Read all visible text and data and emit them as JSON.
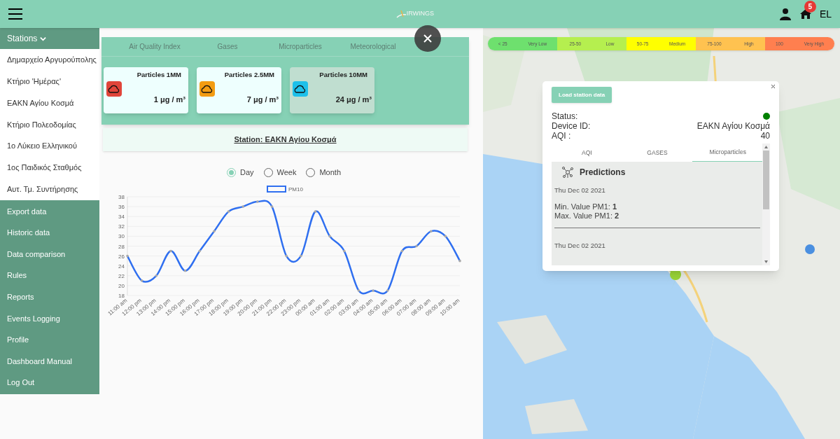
{
  "header": {
    "logo": "IRWINGS",
    "notification_count": "5",
    "language": "EL"
  },
  "sidebar": {
    "section": {
      "label": "Stations",
      "expanded": true
    },
    "stations": [
      {
        "label": "Δημαρχείο Αργυρούπολης"
      },
      {
        "label": "Κτήριο 'Ημέρας'"
      },
      {
        "label": "ΕΑΚΝ Αγίου Κοσμά"
      },
      {
        "label": "Κτήριο Πολεοδομίας"
      },
      {
        "label": "1ο Λύκειο Ελληνικού"
      },
      {
        "label": "1ος Παιδικός Σταθμός"
      },
      {
        "label": "Αυτ. Τμ. Συντήρησης"
      }
    ],
    "items": [
      {
        "label": "Export data"
      },
      {
        "label": "Historic data"
      },
      {
        "label": "Data comparison"
      },
      {
        "label": "Rules"
      },
      {
        "label": "Reports"
      },
      {
        "label": "Events Logging"
      },
      {
        "label": "Profile"
      },
      {
        "label": "Dashboard Manual"
      },
      {
        "label": "Log Out"
      }
    ]
  },
  "panel": {
    "tabs": [
      {
        "label": "Air Quality Index"
      },
      {
        "label": "Gases"
      },
      {
        "label": "Microparticles"
      },
      {
        "label": "Meteorological"
      }
    ],
    "cards": [
      {
        "title": "Particles 1MM",
        "value": "1 μg / m³",
        "color": "#e0453a",
        "selected": false
      },
      {
        "title": "Particles 2.5MM",
        "value": "7 μg / m³",
        "color": "#f39c12",
        "selected": false
      },
      {
        "title": "Particles 10MM",
        "value": "24 μg / m³",
        "color": "#1ec0ea",
        "selected": true
      }
    ],
    "station_title": "Station: ΕΑΚΝ Αγίου Κοσμά",
    "periods": [
      {
        "label": "Day",
        "selected": true
      },
      {
        "label": "Week",
        "selected": false
      },
      {
        "label": "Month",
        "selected": false
      }
    ],
    "chart_data": {
      "type": "line",
      "categories": [
        "11:00 am",
        "12:00 pm",
        "13:00 pm",
        "14:00 pm",
        "15:00 pm",
        "16:00 pm",
        "17:00 pm",
        "18:00 pm",
        "19:00 pm",
        "20:00 pm",
        "21:00 pm",
        "22:00 pm",
        "23:00 pm",
        "00:00 am",
        "01:00 am",
        "02:00 am",
        "03:00 am",
        "04:00 am",
        "05:00 am",
        "06:00 am",
        "07:00 am",
        "08:00 am",
        "09:00 am",
        "10:00 am"
      ],
      "series": [
        {
          "name": "PM10",
          "color": "#2f6ff0",
          "values": [
            26,
            21,
            22,
            27,
            23,
            27,
            31,
            35,
            36,
            37,
            36,
            26,
            26,
            35,
            30,
            27,
            19,
            19,
            19,
            27,
            28,
            31,
            30,
            25
          ]
        }
      ],
      "grid": true,
      "ylim": [
        18,
        38
      ],
      "yticks": [
        18,
        20,
        22,
        24,
        26,
        28,
        30,
        32,
        34,
        36,
        38
      ]
    }
  },
  "legend": [
    {
      "range": "< 25",
      "label": "Very Low",
      "color": "#6ee06e"
    },
    {
      "range": "25-50",
      "label": "Low",
      "color": "#b5ef4f"
    },
    {
      "range": "50-75",
      "label": "Medium",
      "color": "#ffff00"
    },
    {
      "range": "75-100",
      "label": "High",
      "color": "#ffc250"
    },
    {
      "range": "100",
      "label": "Very High",
      "color": "#ff7f4f"
    }
  ],
  "popup": {
    "button": "Load station data",
    "online": true,
    "fields": [
      {
        "label": "Status:"
      },
      {
        "label": "Device ID:",
        "value": "ΕΑΚΝ Αγίου Κοσμά"
      },
      {
        "label": "AQI :",
        "value": "40"
      }
    ],
    "tabs": [
      {
        "label": "AQI",
        "selected": false
      },
      {
        "label": "GASES",
        "selected": false
      },
      {
        "label": "Microparticles",
        "selected": true
      }
    ],
    "heading": "Predictions",
    "predictions": [
      {
        "date": "Thu Dec 02 2021",
        "lines": [
          "Min. Value PM1: **1**",
          "Max. Value PM1: **2**"
        ]
      },
      {
        "date": "Thu Dec 02 2021"
      }
    ]
  }
}
